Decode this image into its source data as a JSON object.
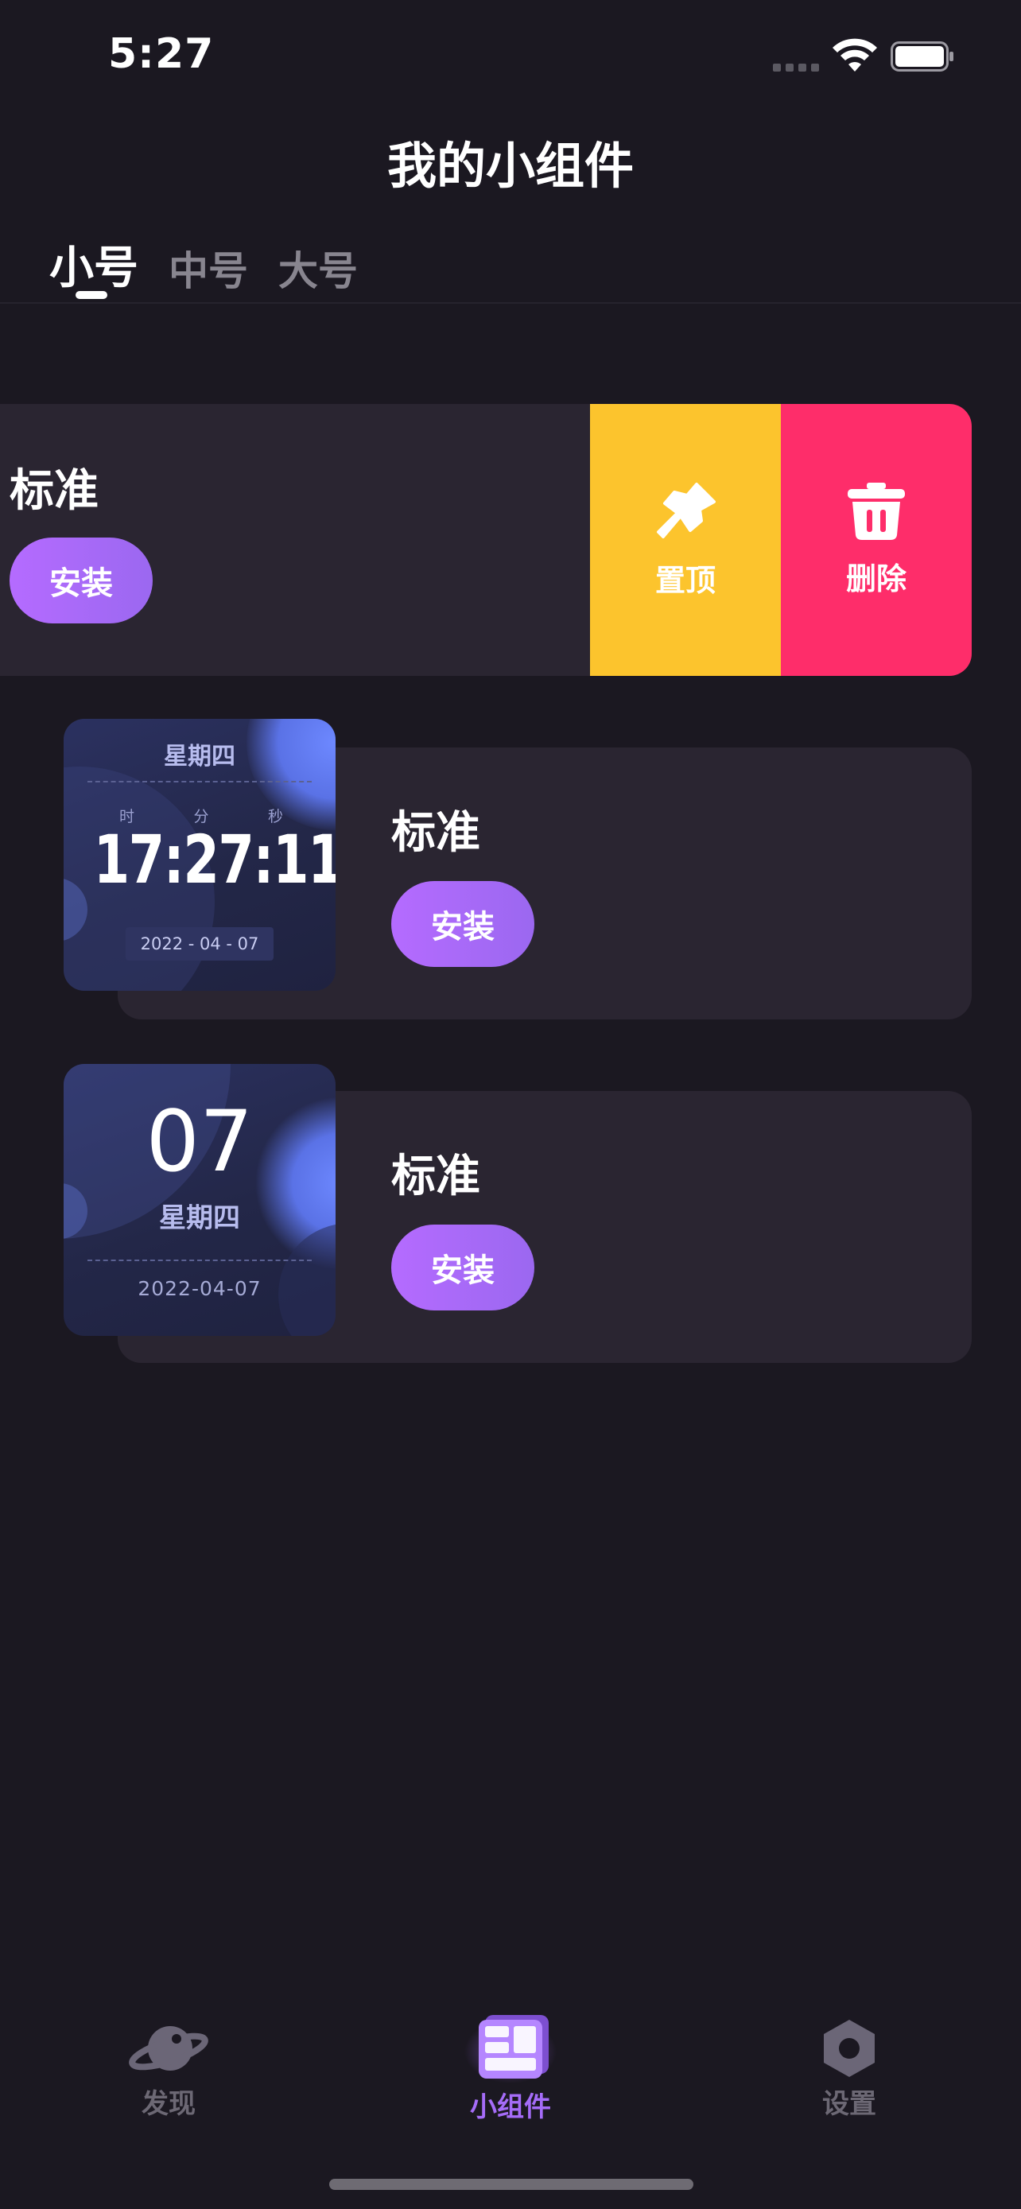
{
  "status_bar": {
    "time": "5:27"
  },
  "header": {
    "title": "我的小组件"
  },
  "tabs": [
    {
      "label": "小号",
      "active": true
    },
    {
      "label": "中号",
      "active": false
    },
    {
      "label": "大号",
      "active": false
    }
  ],
  "widgets": [
    {
      "title": "标准",
      "install_label": "安装",
      "swipe_actions": {
        "pin_label": "置顶",
        "delete_label": "删除"
      }
    },
    {
      "title": "标准",
      "install_label": "安装",
      "preview": {
        "weekday": "星期四",
        "hour_label": "时",
        "minute_label": "分",
        "second_label": "秒",
        "time": "17:27:11",
        "date": "2022 - 04 - 07"
      }
    },
    {
      "title": "标准",
      "install_label": "安装",
      "preview": {
        "day": "07",
        "weekday": "星期四",
        "date": "2022-04-07"
      }
    }
  ],
  "tab_bar": [
    {
      "label": "发现",
      "icon": "planet-icon",
      "active": false
    },
    {
      "label": "小组件",
      "icon": "widget-grid-icon",
      "active": true
    },
    {
      "label": "设置",
      "icon": "hex-nut-icon",
      "active": false
    }
  ],
  "colors": {
    "background": "#1b1821",
    "card": "#2a2531",
    "accent_purple": "#a56cf8",
    "pin_yellow": "#fcc42d",
    "delete_pink": "#fe2d6a"
  }
}
